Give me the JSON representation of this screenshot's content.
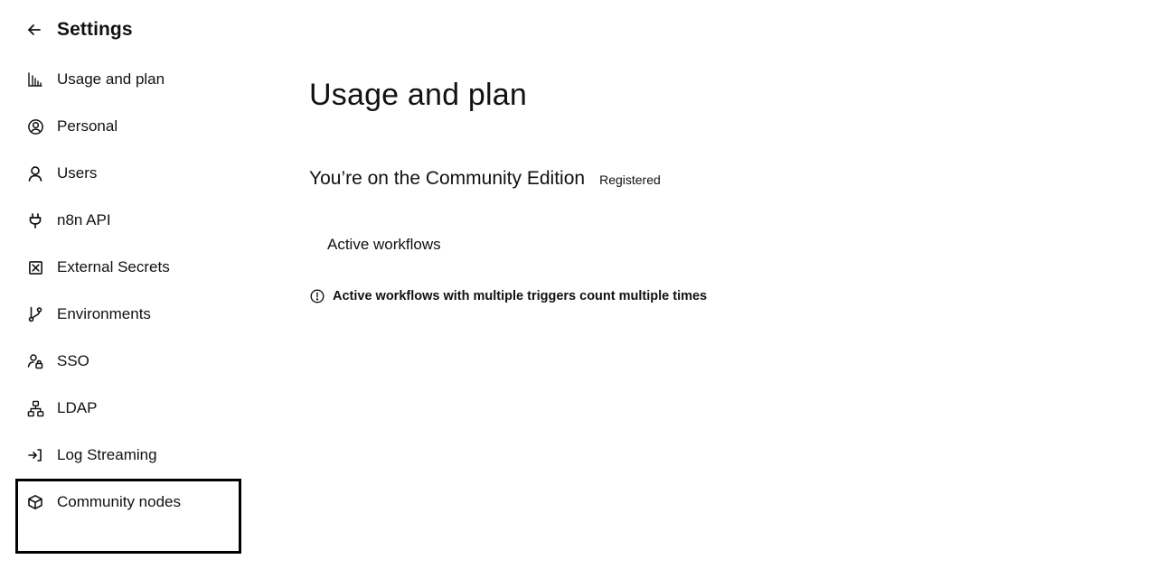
{
  "sidebar": {
    "back_icon": "arrow-left-icon",
    "title": "Settings",
    "items": [
      {
        "label": "Usage and plan",
        "icon": "bar-chart-icon"
      },
      {
        "label": "Personal",
        "icon": "user-circle-icon"
      },
      {
        "label": "Users",
        "icon": "user-icon"
      },
      {
        "label": "n8n API",
        "icon": "plug-icon"
      },
      {
        "label": "External Secrets",
        "icon": "vault-icon"
      },
      {
        "label": "Environments",
        "icon": "git-branch-icon"
      },
      {
        "label": "SSO",
        "icon": "user-lock-icon"
      },
      {
        "label": "LDAP",
        "icon": "network-icon"
      },
      {
        "label": "Log Streaming",
        "icon": "sign-in-icon"
      },
      {
        "label": "Community nodes",
        "icon": "cube-icon"
      }
    ]
  },
  "main": {
    "title": "Usage and plan",
    "edition_text": "You’re on the Community Edition",
    "edition_badge": "Registered",
    "active_workflows_label": "Active workflows",
    "info_icon": "info-circle-icon",
    "info_text": "Active workflows with multiple triggers count multiple times"
  },
  "colors": {
    "text": "#111111",
    "background": "#ffffff",
    "highlight_border": "#000000"
  }
}
